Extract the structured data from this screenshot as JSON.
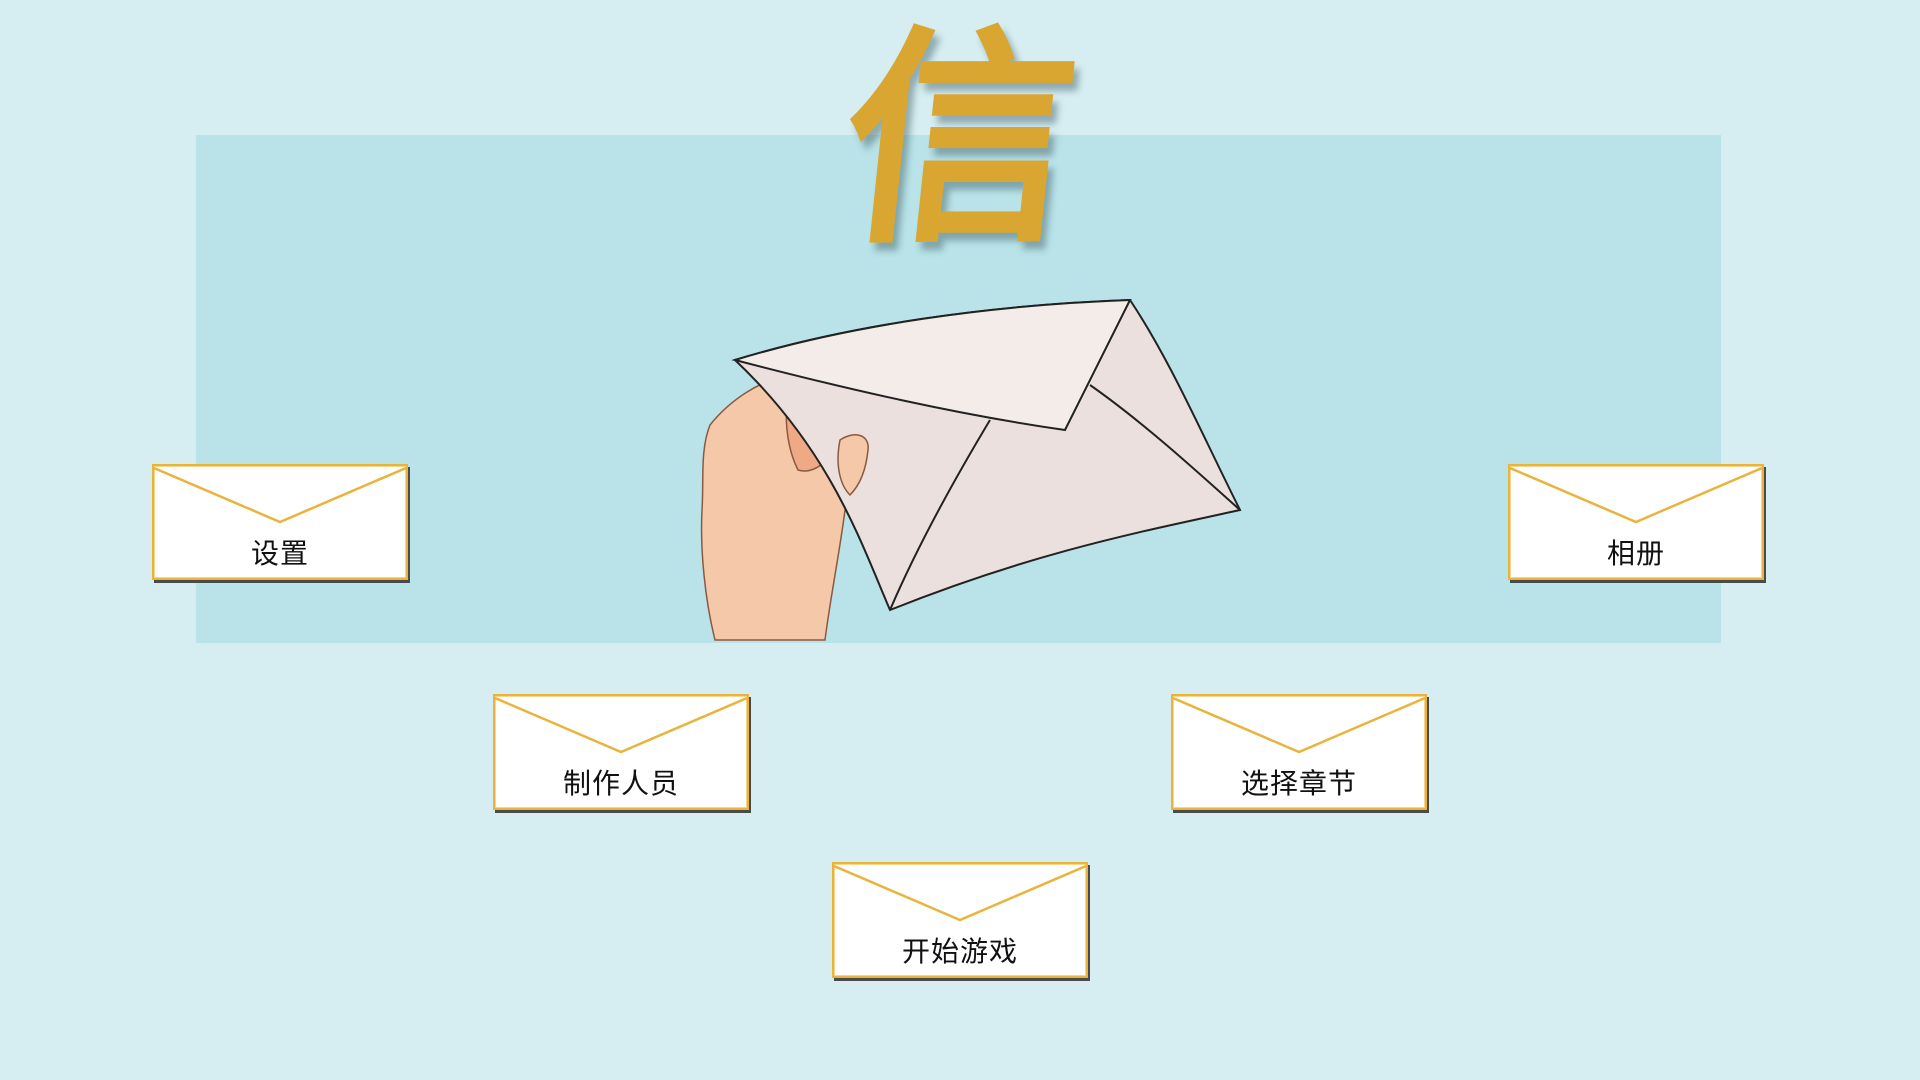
{
  "title": "信",
  "menu": {
    "settings": "设置",
    "album": "相册",
    "credits": "制作人员",
    "chapter_select": "选择章节",
    "start_game": "开始游戏"
  },
  "icons": {
    "button_icon": "envelope-icon",
    "illustration": "hand-holding-envelope"
  },
  "colors": {
    "background": "#d6eef1",
    "panel": "#b9e3e8",
    "title": "#d9a632",
    "button_border": "#e9b33c"
  }
}
